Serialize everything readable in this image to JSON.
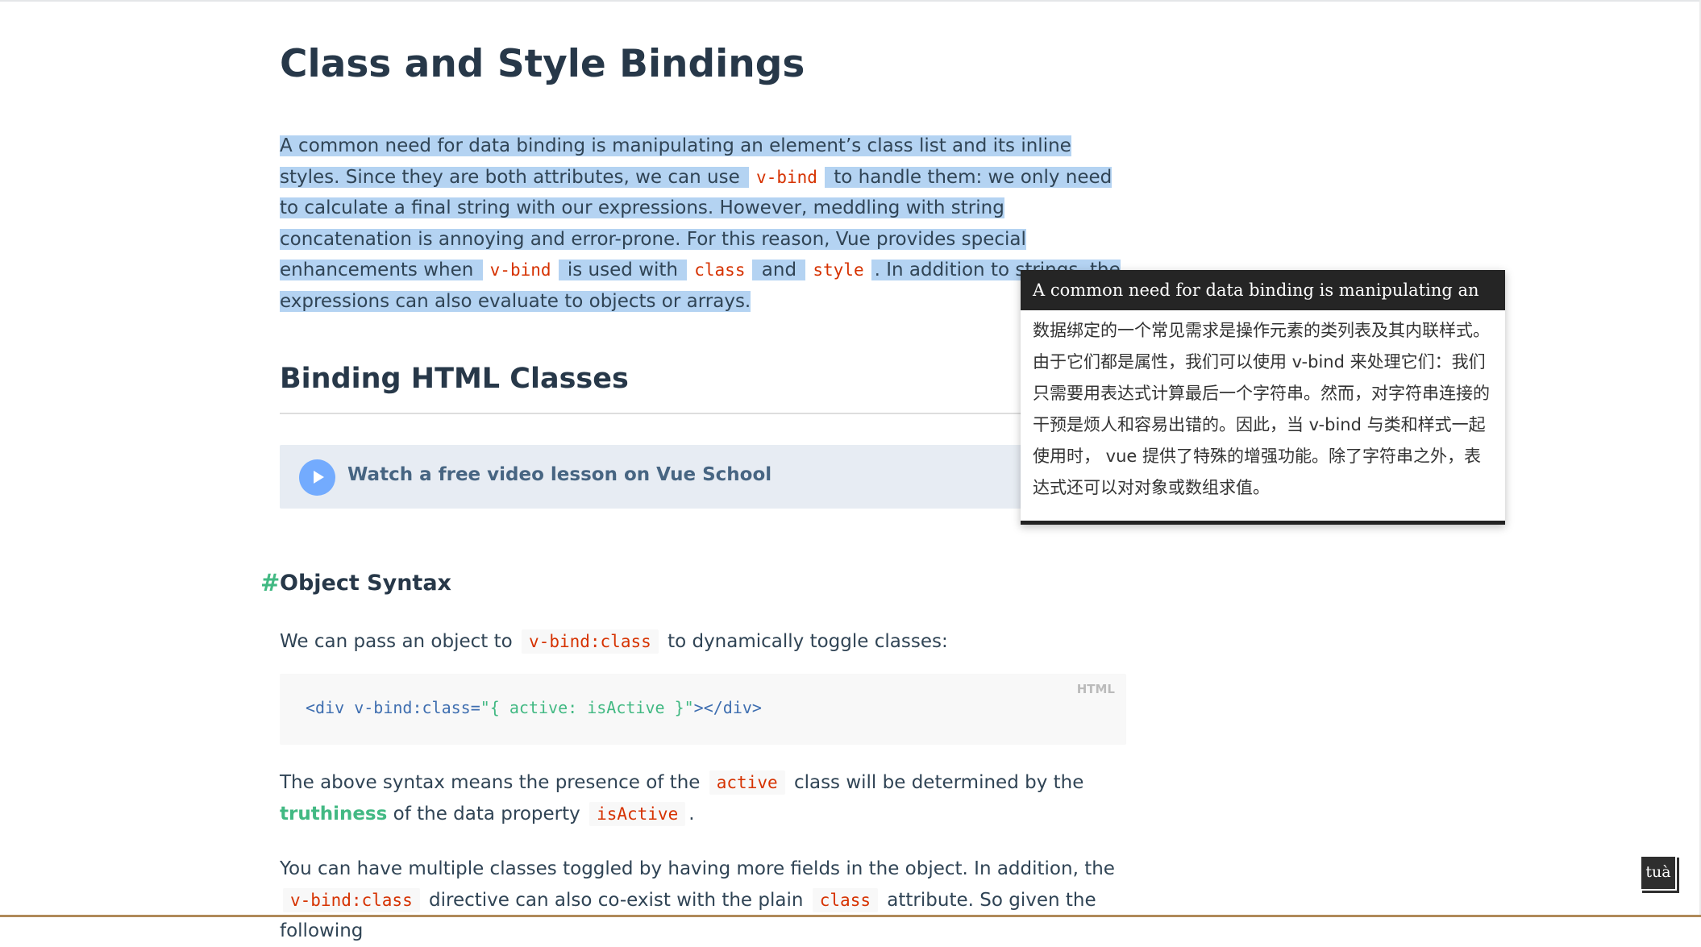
{
  "page": {
    "title": "Class and Style Bindings",
    "intro": {
      "t1": "A common need for data binding is manipulating an element’s class list and its inline styles. Since they are both attributes, we can use",
      "c1": "v-bind",
      "t2": "to handle them: we only need to calculate a final string with our expressions. However, meddling with string concatenation is annoying and error-prone. For this reason, Vue provides special enhancements when",
      "c2": "v-bind",
      "t3": "is used with",
      "c3": "class",
      "t4": "and",
      "c4": "style",
      "t5": ". In addition to strings, the expressions can also evaluate to objects or arrays."
    },
    "section_heading": "Binding HTML Classes",
    "video_lesson_label": "Watch a free video lesson on Vue School",
    "object_syntax": {
      "anchor": "#",
      "heading": "Object Syntax",
      "p1_before": "We can pass an object to",
      "p1_code": "v-bind:class",
      "p1_after": "to dynamically toggle classes:",
      "code_lang": "HTML",
      "code_tag_open": "<div v-bind:class=",
      "code_string": "\"{ active: isActive }\"",
      "code_tag_close": "></div>",
      "p2_before": "The above syntax means the presence of the",
      "p2_code1": "active",
      "p2_mid": "class will be determined by the",
      "p2_link": "truthiness",
      "p2_after": "of the data property",
      "p2_code2": "isActive",
      "p2_end": ".",
      "p3_before": "You can have multiple classes toggled by having more fields in the object. In addition, the",
      "p3_code1": "v-bind:class",
      "p3_mid": "directive can also co-exist with the plain",
      "p3_code2": "class",
      "p3_after": "attribute. So given the following"
    }
  },
  "translation_popup": {
    "source_text": "A common need for data binding is manipulating an",
    "translation": "数据绑定的一个常见需求是操作元素的类列表及其内联样式。由于它们都是属性，我们可以使用 v-bind 来处理它们：我们只需要用表达式计算最后一个字符串。然而，对字符串连接的干预是烦人和容易出错的。因此，当 v-bind 与类和样式一起使用时， vue 提供了特殊的增强功能。除了字符串之外，表达式还可以对对象或数组求值。"
  },
  "extension_button": {
    "label": "tuà"
  }
}
